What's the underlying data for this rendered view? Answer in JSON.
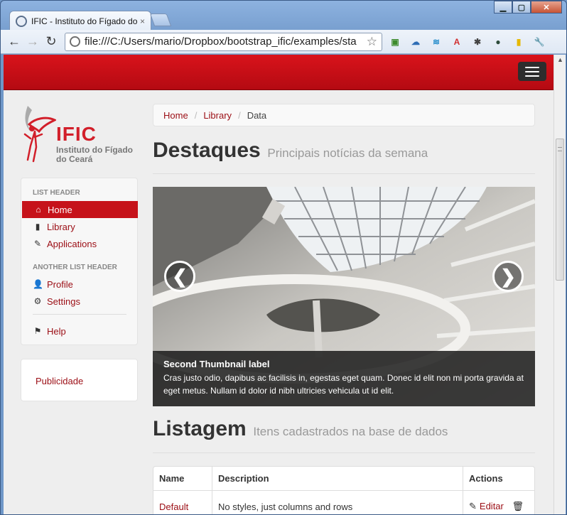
{
  "browser": {
    "tab_title": "IFIC - Instituto do Fígado do",
    "tab_close": "×",
    "url": "file:///C:/Users/mario/Dropbox/bootstrap_ific/examples/sta",
    "window_buttons": {
      "minimize": "▁",
      "maximize": "▢",
      "close": "✕"
    },
    "nav": {
      "back": "←",
      "forward": "→",
      "reload": "↻"
    },
    "star": "☆",
    "extensions": [
      {
        "name": "ext-green-icon",
        "glyph": "▣",
        "color": "#3d8b2d"
      },
      {
        "name": "cloud-icon",
        "glyph": "☁",
        "color": "#2f6db5"
      },
      {
        "name": "wave-icon",
        "glyph": "≋",
        "color": "#1d88c9"
      },
      {
        "name": "translate-icon",
        "glyph": "A",
        "color": "#d12f2f"
      },
      {
        "name": "bug-icon",
        "glyph": "✱",
        "color": "#444444"
      },
      {
        "name": "orb-icon",
        "glyph": "●",
        "color": "#2c4b3a"
      },
      {
        "name": "phone-icon",
        "glyph": "▮",
        "color": "#e6b800"
      },
      {
        "name": "wrench-icon",
        "glyph": "🔧",
        "color": "#555555"
      }
    ]
  },
  "logo": {
    "acronym": "IFIC",
    "line1": "Instituto do Fígado",
    "line2": "do Ceará"
  },
  "sidebar": {
    "header1": "LIST HEADER",
    "header2": "ANOTHER LIST HEADER",
    "items": [
      {
        "label": "Home",
        "icon": "⌂",
        "icon_name": "home-icon"
      },
      {
        "label": "Library",
        "icon": "▮",
        "icon_name": "book-icon"
      },
      {
        "label": "Applications",
        "icon": "✎",
        "icon_name": "pencil-icon"
      },
      {
        "label": "Profile",
        "icon": "👤",
        "icon_name": "user-icon"
      },
      {
        "label": "Settings",
        "icon": "⚙",
        "icon_name": "gear-icon"
      },
      {
        "label": "Help",
        "icon": "⚑",
        "icon_name": "flag-icon"
      }
    ],
    "ad_label": "Publicidade"
  },
  "breadcrumb": {
    "home": "Home",
    "library": "Library",
    "current": "Data",
    "separator": "/"
  },
  "destaques": {
    "title": "Destaques",
    "subtitle": "Principais notícias da semana"
  },
  "carousel": {
    "prev": "❮",
    "next": "❯",
    "caption_title": "Second Thumbnail label",
    "caption_text": "Cras justo odio, dapibus ac facilisis in, egestas eget quam. Donec id elit non mi porta gravida at eget metus. Nullam id dolor id nibh ultricies vehicula ut id elit."
  },
  "listagem": {
    "title": "Listagem",
    "subtitle": "Itens cadastrados na base de dados"
  },
  "table": {
    "headers": {
      "name": "Name",
      "description": "Description",
      "actions": "Actions"
    },
    "rows": [
      {
        "name": "Default",
        "description": "No styles, just columns and rows",
        "edit_label": "Editar",
        "edit_icon": "✎",
        "trash_icon": "🗑"
      }
    ]
  },
  "colors": {
    "brand_red": "#c6121a",
    "link_red": "#9b0d14"
  }
}
